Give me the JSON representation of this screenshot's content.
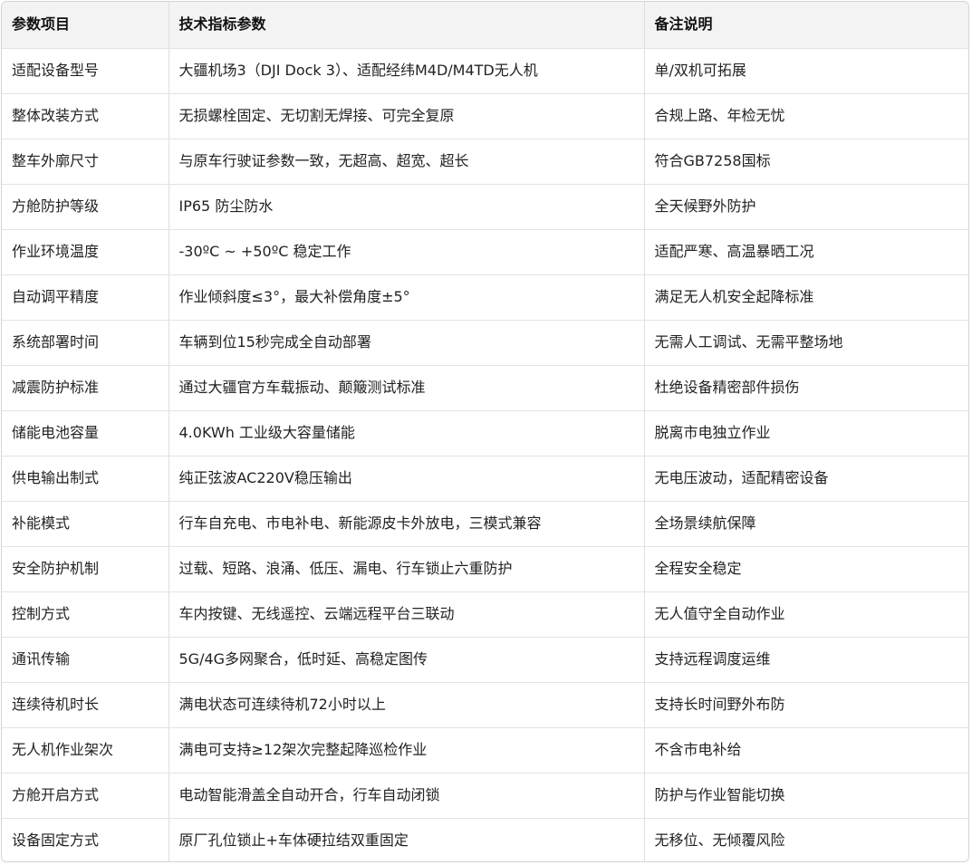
{
  "table": {
    "headers": [
      "参数项目",
      "技术指标参数",
      "备注说明"
    ],
    "rows": [
      [
        "适配设备型号",
        "大疆机场3（DJI Dock 3）、适配经纬M4D/M4TD无人机",
        "单/双机可拓展"
      ],
      [
        "整体改装方式",
        "无损螺栓固定、无切割无焊接、可完全复原",
        "合规上路、年检无忧"
      ],
      [
        "整车外廓尺寸",
        "与原车行驶证参数一致，无超高、超宽、超长",
        "符合GB7258国标"
      ],
      [
        "方舱防护等级",
        "IP65 防尘防水",
        "全天候野外防护"
      ],
      [
        "作业环境温度",
        "-30ºC ~ +50ºC 稳定工作",
        "适配严寒、高温暴晒工况"
      ],
      [
        "自动调平精度",
        "作业倾斜度≤3°，最大补偿角度±5°",
        "满足无人机安全起降标准"
      ],
      [
        "系统部署时间",
        "车辆到位15秒完成全自动部署",
        "无需人工调试、无需平整场地"
      ],
      [
        "减震防护标准",
        "通过大疆官方车载振动、颠簸测试标准",
        "杜绝设备精密部件损伤"
      ],
      [
        "储能电池容量",
        "4.0KWh 工业级大容量储能",
        "脱离市电独立作业"
      ],
      [
        "供电输出制式",
        "纯正弦波AC220V稳压输出",
        "无电压波动，适配精密设备"
      ],
      [
        "补能模式",
        "行车自充电、市电补电、新能源皮卡外放电，三模式兼容",
        "全场景续航保障"
      ],
      [
        "安全防护机制",
        "过载、短路、浪涌、低压、漏电、行车锁止六重防护",
        "全程安全稳定"
      ],
      [
        "控制方式",
        "车内按键、无线遥控、云端远程平台三联动",
        "无人值守全自动作业"
      ],
      [
        "通讯传输",
        "5G/4G多网聚合，低时延、高稳定图传",
        "支持远程调度运维"
      ],
      [
        "连续待机时长",
        "满电状态可连续待机72小时以上",
        "支持长时间野外布防"
      ],
      [
        "无人机作业架次",
        "满电可支持≥12架次完整起降巡检作业",
        "不含市电补给"
      ],
      [
        "方舱开启方式",
        "电动智能滑盖全自动开合，行车自动闭锁",
        "防护与作业智能切换"
      ],
      [
        "设备固定方式",
        "原厂孔位锁止+车体硬拉结双重固定",
        "无移位、无倾覆风险"
      ]
    ]
  }
}
